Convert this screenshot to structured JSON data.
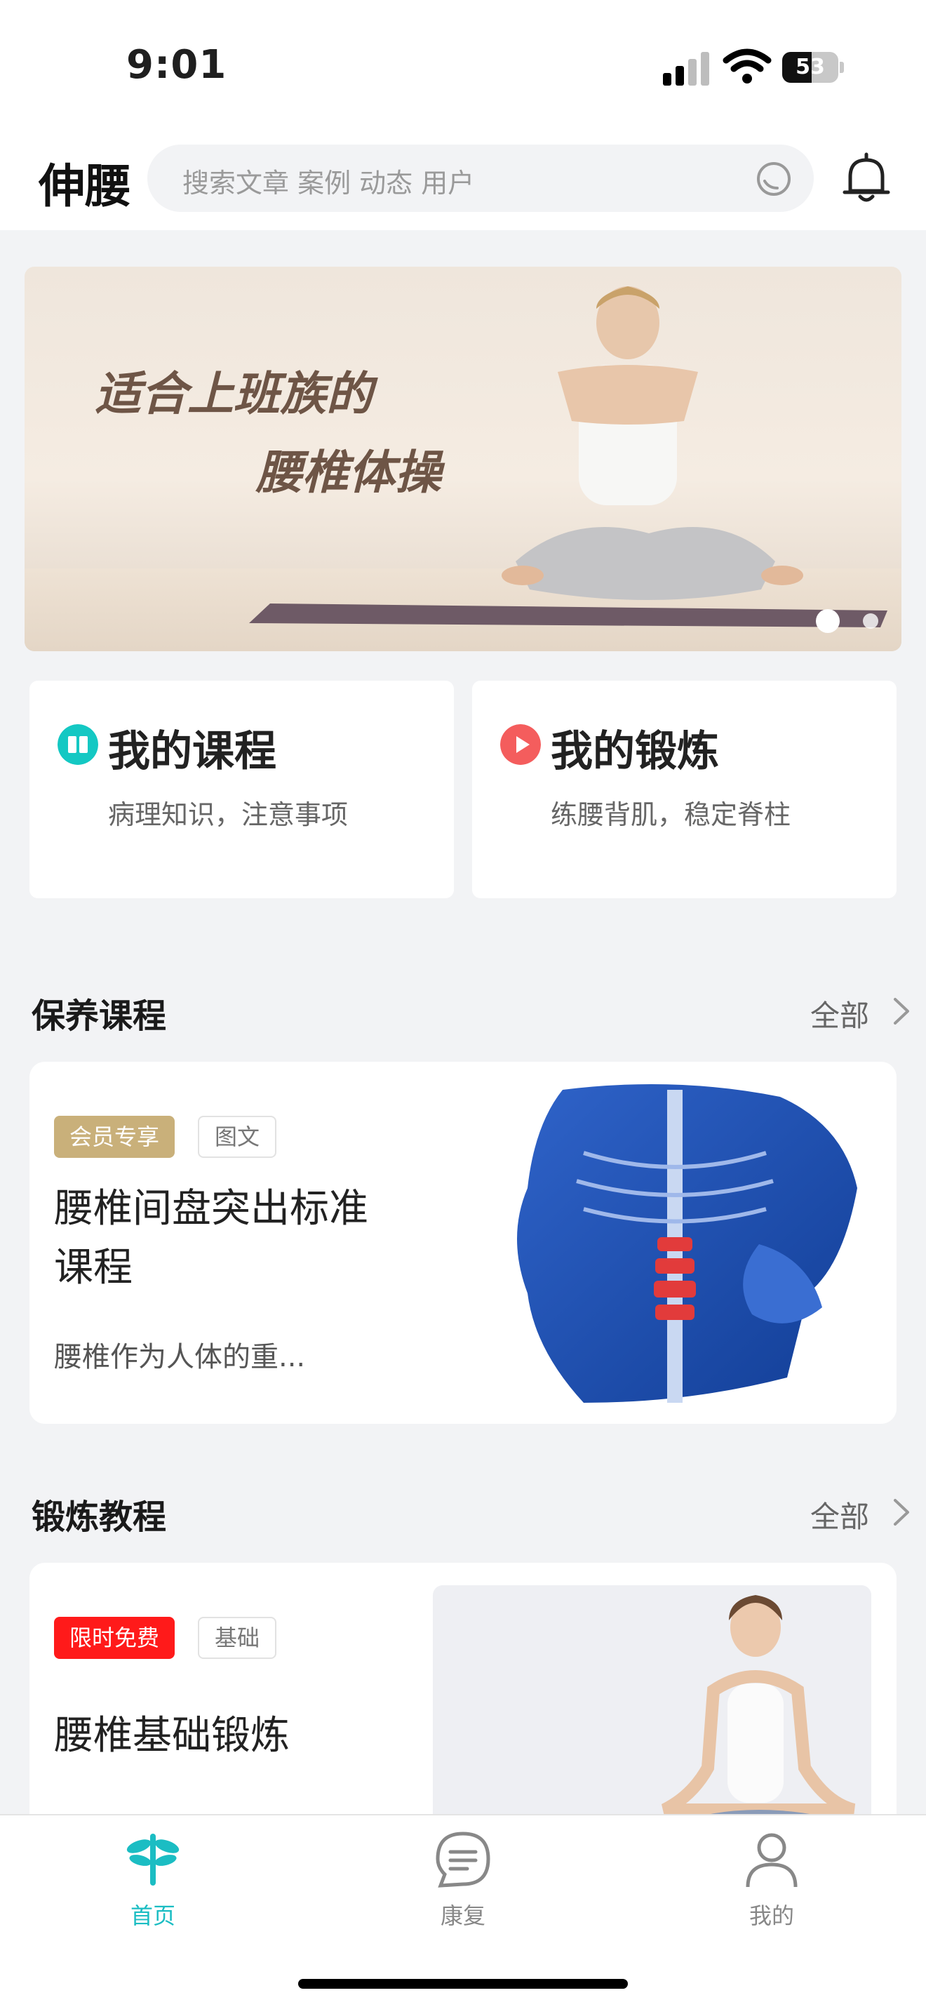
{
  "status": {
    "time": "9:01",
    "battery": "53",
    "battery_level": 0.53
  },
  "header": {
    "brand": "伸腰",
    "search_placeholder": "搜索文章 案例 动态 用户"
  },
  "banner": {
    "line1": "适合上班族的",
    "line2": "腰椎体操",
    "slide_count": 2,
    "active_slide": 1
  },
  "quick": [
    {
      "title": "我的课程",
      "subtitle": "病理知识，注意事项",
      "icon": "book-icon",
      "color": "#14c8c3"
    },
    {
      "title": "我的锻炼",
      "subtitle": "练腰背肌，稳定脊柱",
      "icon": "play-icon",
      "color": "#f45d5d"
    }
  ],
  "section_care": {
    "title": "保养课程",
    "all": "全部"
  },
  "course_card": {
    "tags": [
      "会员专享",
      "图文"
    ],
    "title_line1": "腰椎间盘突出标准",
    "title_line2": "课程",
    "desc": "腰椎作为人体的重..."
  },
  "section_exercise": {
    "title": "锻炼教程",
    "all": "全部"
  },
  "exercise_card": {
    "tags": [
      "限时免费",
      "基础"
    ],
    "title": "腰椎基础锻炼"
  },
  "tabbar": [
    {
      "label": "首页",
      "icon": "dragonfly-icon",
      "active": true
    },
    {
      "label": "康复",
      "icon": "chat-icon",
      "active": false
    },
    {
      "label": "我的",
      "icon": "user-icon",
      "active": false
    }
  ],
  "colors": {
    "accent": "#1bbdc3",
    "member_tag": "#c9b07a",
    "free_tag": "#ff1a1a",
    "inactive": "#888888"
  }
}
